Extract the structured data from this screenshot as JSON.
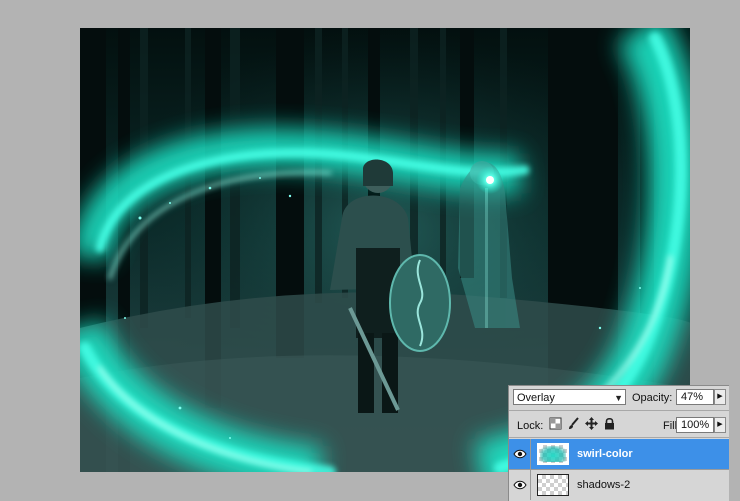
{
  "layers_panel": {
    "blend_mode": "Overlay",
    "opacity_label": "Opacity:",
    "opacity_value": "47%",
    "lock_label": "Lock:",
    "fill_label": "Fill:",
    "fill_value": "100%",
    "layers": [
      {
        "name": "swirl-color",
        "selected": true,
        "visible": true
      },
      {
        "name": "shadows-2",
        "selected": false,
        "visible": true
      }
    ]
  },
  "colors": {
    "accent_selected": "#3d90e8",
    "swirl_teal": "#1fe6c8",
    "forest_dark": "#061614"
  },
  "icons": [
    "chevron-down-icon",
    "triangle-right-icon",
    "lock-transparent-icon",
    "lock-paint-icon",
    "lock-move-icon",
    "lock-all-icon",
    "eye-icon"
  ]
}
